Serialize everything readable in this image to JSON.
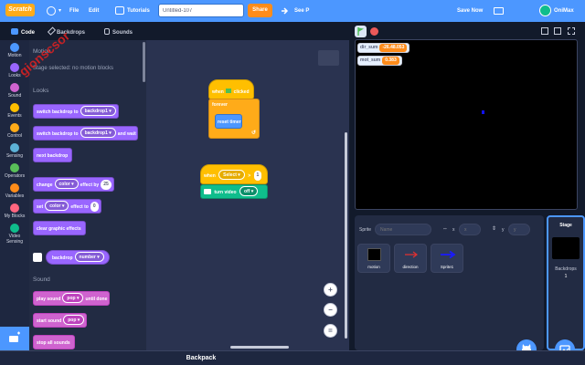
{
  "menubar": {
    "logo": "Scratch",
    "file": "File",
    "edit": "Edit",
    "tutorials": "Tutorials",
    "project_title": "Untitled-107",
    "share": "Share",
    "see_project": "See P",
    "save_now": "Save Now",
    "username": "OniMax",
    "accent_color": "#4c97ff"
  },
  "tabs": {
    "code": "Code",
    "backdrops": "Backdrops",
    "sounds": "Sounds"
  },
  "categories": [
    {
      "label": "Motion",
      "color": "#4c97ff"
    },
    {
      "label": "Looks",
      "color": "#9966ff"
    },
    {
      "label": "Sound",
      "color": "#cf63cf"
    },
    {
      "label": "Events",
      "color": "#ffbf00"
    },
    {
      "label": "Control",
      "color": "#ffab19"
    },
    {
      "label": "Sensing",
      "color": "#5cb1d6"
    },
    {
      "label": "Operators",
      "color": "#59c059"
    },
    {
      "label": "Variables",
      "color": "#ff8c1a"
    },
    {
      "label": "My Blocks",
      "color": "#ff6680"
    },
    {
      "label": "Video Sensing",
      "color": "#0fbd8c"
    }
  ],
  "palette": {
    "motion_heading": "Motion",
    "motion_note": "Stage selected: no motion blocks",
    "looks_heading": "Looks",
    "blocks": {
      "switch_backdrop": "switch backdrop to",
      "switch_backdrop_val": "backdrop1",
      "switch_backdrop_wait": "switch backdrop to",
      "switch_backdrop_wait_val": "backdrop1",
      "and_wait": "and wait",
      "next_backdrop": "next backdrop",
      "change_effect": "change",
      "change_effect_val": "color",
      "effect_by": "effect by",
      "effect_by_num": "25",
      "set_effect": "set",
      "set_effect_val": "color",
      "effect_to": "effect to",
      "effect_to_num": "0",
      "clear_effects": "clear graphic effects",
      "backdrop_reporter": "backdrop",
      "backdrop_reporter_val": "number"
    },
    "sound_heading": "Sound",
    "sound_blocks": {
      "play_until_done": "play sound",
      "play_until_done_val": "pop",
      "until_done": "until done",
      "start_sound": "start sound",
      "start_sound_val": "pop",
      "stop_all": "stop all sounds"
    }
  },
  "script": {
    "when_flag": "when",
    "clicked": "clicked",
    "forever": "forever",
    "reset_timer": "reset timer",
    "when_key": "when",
    "key_val": "Select",
    "gt": ">",
    "key_num": "1",
    "turn_video": "turn video",
    "video_val": "off"
  },
  "stage": {
    "monitors": [
      {
        "label": "dir_sum",
        "value": "-26.48.053"
      },
      {
        "label": "mot_sum",
        "value": "0.383"
      }
    ]
  },
  "sprite_info": {
    "sprite_label": "Sprite",
    "sprite_placeholder": "Name",
    "x_label": "x",
    "x_placeholder": "x",
    "y_label": "y",
    "y_placeholder": "y"
  },
  "sprites": [
    {
      "name": "motion"
    },
    {
      "name": "direction"
    },
    {
      "name": "Sprite1"
    }
  ],
  "stage_pane": {
    "label": "Stage",
    "backdrops_label": "Backdrops",
    "backdrop_count": "1"
  },
  "backpack": "Backpack"
}
